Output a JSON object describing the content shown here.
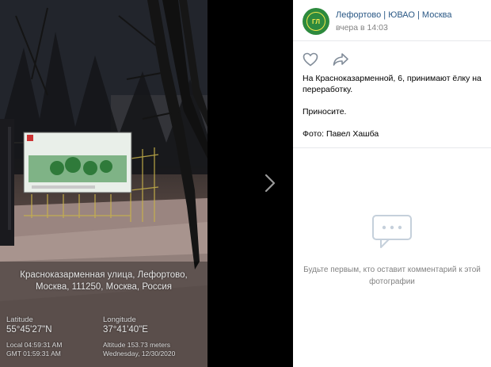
{
  "photo": {
    "sign_line1": "БЛАГОДАРЯ ВАМ",
    "sign_line2": "ГОРОД СТАНЕТ ЭКОЛОГИЧНЕЕ",
    "caption": "Красноказарменная улица, Лефортово, Москва, 111250, Москва, Россия",
    "latitude_label": "Latitude",
    "latitude_value": "55°45'27\"N",
    "longitude_label": "Longitude",
    "longitude_value": "37°41'40\"E",
    "local_time": "Local 04:59:31 AM",
    "gmt_time": "GMT 01:59:31 AM",
    "altitude": "Altitude 153.73 meters",
    "date": "Wednesday, 12/30/2020"
  },
  "viewer": {
    "next_icon": "chevron-right-icon"
  },
  "post": {
    "group_name": "Лефортово | ЮВАО | Москва",
    "avatar_text": "ГЛ",
    "time": "вчера в 14:03",
    "like_icon": "heart-icon",
    "share_icon": "share-arrow-icon",
    "text_line1": "На Красноказарменной, 6, принимают ёлку на переработку.",
    "text_line2": "Приносите.",
    "text_line3": "Фото: Павел Хашба"
  },
  "comments": {
    "empty_icon": "comment-bubble-icon",
    "empty_text": "Будьте первым, кто оставит комментарий к этой фотографии"
  },
  "colors": {
    "link": "#2a5885",
    "muted": "#828282",
    "avatar_bg": "#2d8a3e",
    "avatar_accent": "#f6e94c"
  }
}
